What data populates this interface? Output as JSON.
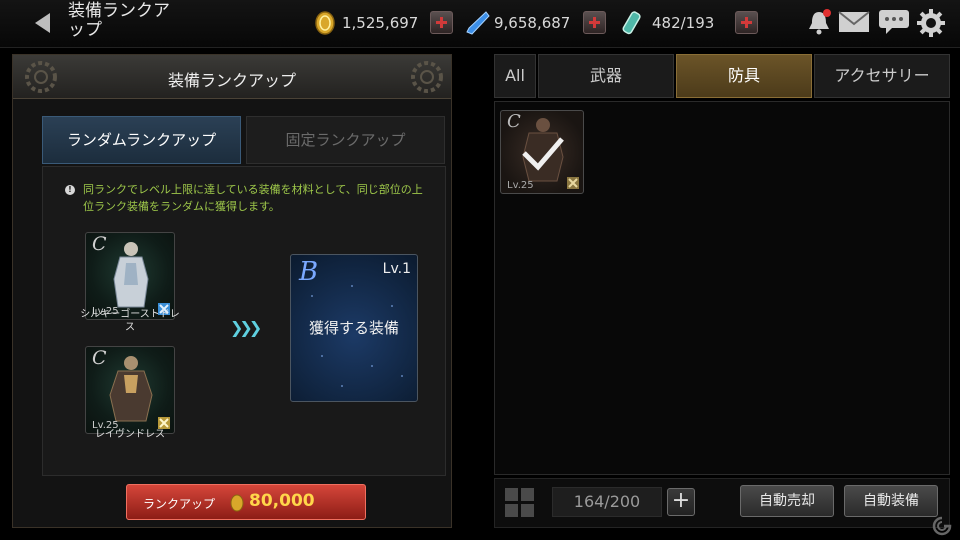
{
  "header": {
    "title": "装備ランクアップ",
    "gold": "1,525,697",
    "crystals": "9,658,687",
    "stamina": "482/193"
  },
  "panel": {
    "title": "装備ランクアップ",
    "tabs": {
      "random": "ランダムランクアップ",
      "fixed": "固定ランクアップ"
    },
    "description": "同ランクでレベル上限に達している装備を材料として、同じ部位の上位ランク装備をランダムに獲得します。",
    "materials": [
      {
        "grade": "C",
        "level": "Lv.25",
        "name": "シルキーゴーストドレス"
      },
      {
        "grade": "C",
        "level": "Lv.25",
        "name": "レイヴンドレス"
      }
    ],
    "result": {
      "grade": "B",
      "level": "Lv.1",
      "label": "獲得する装備"
    },
    "rank_up_button": {
      "label": "ランクアップ",
      "cost": "80,000"
    }
  },
  "inventory": {
    "categories": [
      "All",
      "武器",
      "防具",
      "アクセサリー"
    ],
    "active_category": "防具",
    "items": [
      {
        "grade": "C",
        "level": "Lv.25",
        "selected": true
      }
    ],
    "count": "164/200",
    "expand_label": "+",
    "auto_sell": "自動売却",
    "auto_equip": "自動装備"
  },
  "colors": {
    "accent_blue": "#2b4055",
    "active_tab": "#6b5428",
    "rank_button": "#c13b30",
    "cost_text": "#ffd64a",
    "description_text": "#9ec84a"
  },
  "icons": [
    "back-arrow-icon",
    "gold-coin-icon",
    "crystal-icon",
    "stamina-vial-icon",
    "bell-icon",
    "mail-icon",
    "chat-icon",
    "gear-icon",
    "grid-icon"
  ]
}
